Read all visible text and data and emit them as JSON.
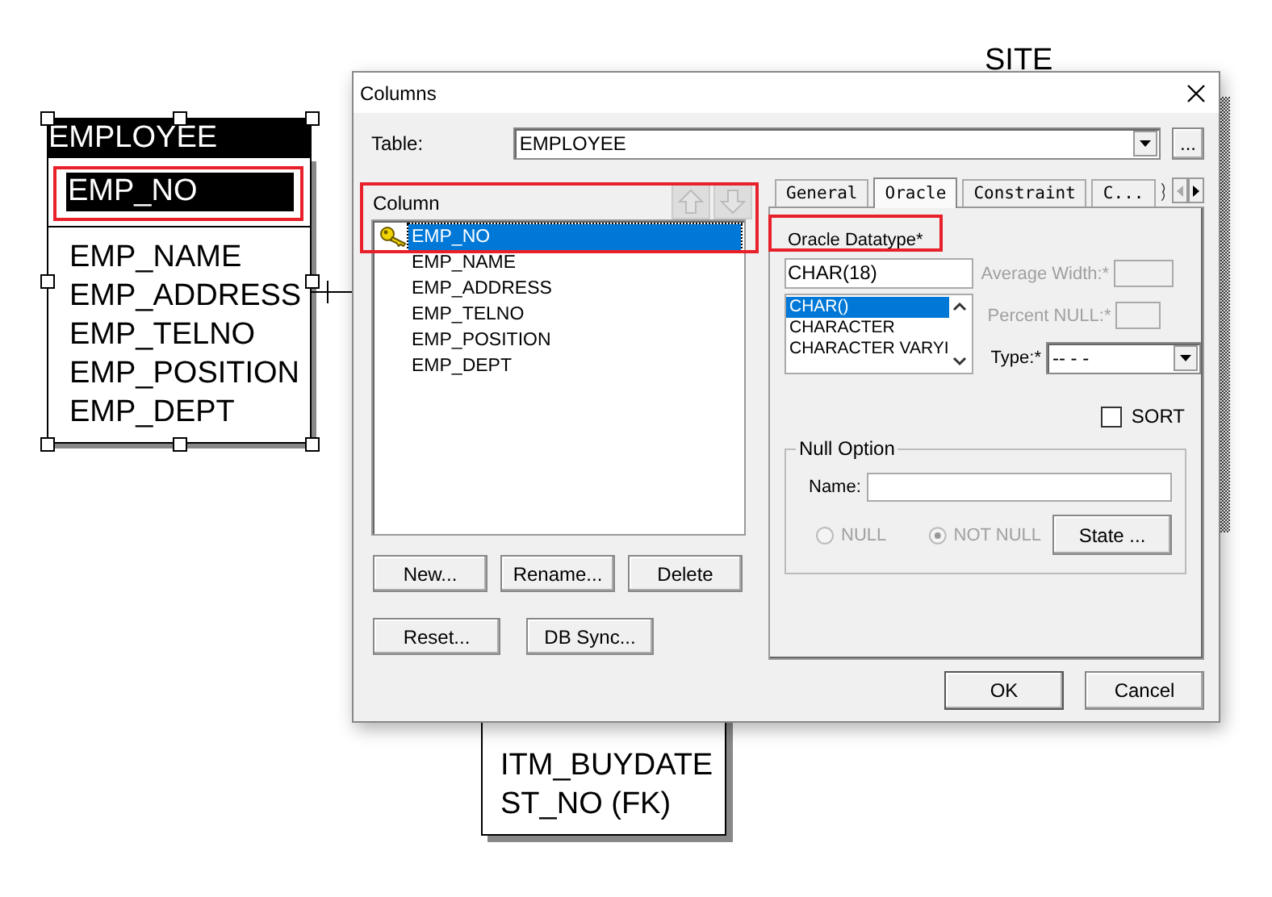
{
  "diagram": {
    "employee_entity": {
      "title": "EMPLOYEE",
      "key_columns": [
        {
          "name": "EMP_NO",
          "selected": true
        }
      ],
      "columns": [
        {
          "name": "EMP_NAME",
          "selected": false
        },
        {
          "name": "EMP_ADDRESS",
          "selected": false
        },
        {
          "name": "EMP_TELNO",
          "selected": false
        },
        {
          "name": "EMP_POSITION",
          "selected": false
        },
        {
          "name": "EMP_DEPT",
          "selected": false
        }
      ]
    },
    "site_entity": {
      "title": "SITE"
    },
    "item_entity": {
      "columns": [
        "ITM_BUYDATE",
        "ST_NO (FK)"
      ]
    }
  },
  "dialog": {
    "title": "Columns",
    "table_label": "Table:",
    "table_value": "EMPLOYEE",
    "browse_button": "...",
    "column_label": "Column",
    "move_buttons": [
      {
        "kind": "up",
        "disabled": true
      },
      {
        "kind": "down",
        "disabled": true
      }
    ],
    "columns": [
      {
        "name": "EMP_NO",
        "key": true,
        "selected": true
      },
      {
        "name": "EMP_NAME",
        "key": false,
        "selected": false
      },
      {
        "name": "EMP_ADDRESS",
        "key": false,
        "selected": false
      },
      {
        "name": "EMP_TELNO",
        "key": false,
        "selected": false
      },
      {
        "name": "EMP_POSITION",
        "key": false,
        "selected": false
      },
      {
        "name": "EMP_DEPT",
        "key": false,
        "selected": false
      }
    ],
    "column_buttons": [
      "New...",
      "Rename...",
      "Delete"
    ],
    "sync_buttons": [
      "Reset...",
      "DB Sync..."
    ],
    "tabs": [
      {
        "label": "General",
        "selected": false
      },
      {
        "label": "Oracle",
        "selected": true
      },
      {
        "label": "Constraint",
        "selected": false
      },
      {
        "label": "C...",
        "selected": false
      }
    ],
    "tab_scroll": [
      {
        "kind": "left",
        "disabled": true
      },
      {
        "kind": "right",
        "disabled": false
      }
    ],
    "oracle": {
      "datatype_label": "Oracle Datatype*",
      "datatype_value": "CHAR(18)",
      "datatypes": [
        {
          "name": "CHAR()",
          "selected": true
        },
        {
          "name": "CHARACTER",
          "selected": false
        },
        {
          "name": "CHARACTER VARYI",
          "selected": false
        }
      ],
      "average_width": {
        "label": "Average Width:*",
        "disabled": true
      },
      "percent_null": {
        "label": "Percent NULL:*",
        "disabled": true
      },
      "type": {
        "label": "Type:*",
        "value": "-- - -"
      },
      "sort": {
        "label": "SORT",
        "checked": false
      },
      "null_option": {
        "title": "Null Option",
        "name_label": "Name:",
        "radios": [
          {
            "label": "NULL",
            "selected": false,
            "disabled": true
          },
          {
            "label": "NOT NULL",
            "selected": true,
            "disabled": true
          }
        ],
        "state_button": "State ..."
      }
    },
    "footer_buttons": [
      "OK",
      "Cancel"
    ]
  }
}
